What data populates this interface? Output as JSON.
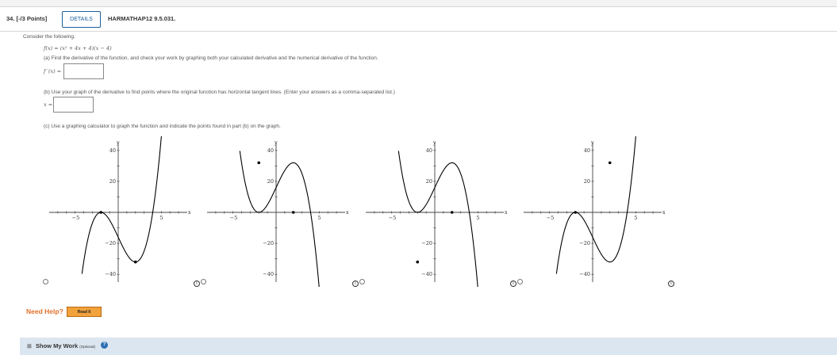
{
  "question": {
    "number": "34.",
    "points": "[-/3 Points]",
    "details_label": "DETAILS",
    "reference": "HARMATHAP12 9.5.031."
  },
  "prompt": "Consider the following.",
  "function_text": "f(x) = (x² + 4x + 4)(x − 4)",
  "part_a": {
    "text": "(a) Find the derivative of the function, and check your work by graphing both your calculated derivative and the numerical derivative of the function.",
    "answer_label": "f ′(x) =",
    "answer_value": ""
  },
  "part_b": {
    "text": "(b) Use your graph of the derivative to find points where the original function has horizontal tangent lines. (Enter your answers as a comma-separated list.)",
    "answer_label": "x =",
    "answer_value": ""
  },
  "part_c": {
    "text": "(c) Use a graphing calculator to graph the function and indicate the points found in part (b) on the graph."
  },
  "graphs": {
    "axis_labels": {
      "x": "x",
      "y": "y"
    },
    "x_ticks": [
      "−5",
      "5"
    ],
    "y_ticks": [
      "40",
      "20",
      "−20",
      "−40"
    ],
    "xlim": [
      -8,
      8
    ],
    "ylim": [
      -45,
      45
    ],
    "options": [
      {
        "sign": 1,
        "marked": [
          [
            -2,
            0
          ],
          [
            2,
            -32
          ]
        ],
        "selected": false
      },
      {
        "sign": -1,
        "marked": [
          [
            -2,
            32
          ],
          [
            2,
            0
          ]
        ],
        "selected": false
      },
      {
        "sign": -1,
        "marked": [
          [
            -2,
            -32
          ],
          [
            2,
            0
          ]
        ],
        "selected": false
      },
      {
        "sign": 1,
        "marked": [
          [
            -2,
            0
          ],
          [
            2,
            32
          ]
        ],
        "selected": false
      }
    ]
  },
  "help": {
    "need_help": "Need Help?",
    "read_it": "Read It"
  },
  "show_work": {
    "label": "Show My Work",
    "optional": "(Optional)",
    "help_icon": "?"
  }
}
